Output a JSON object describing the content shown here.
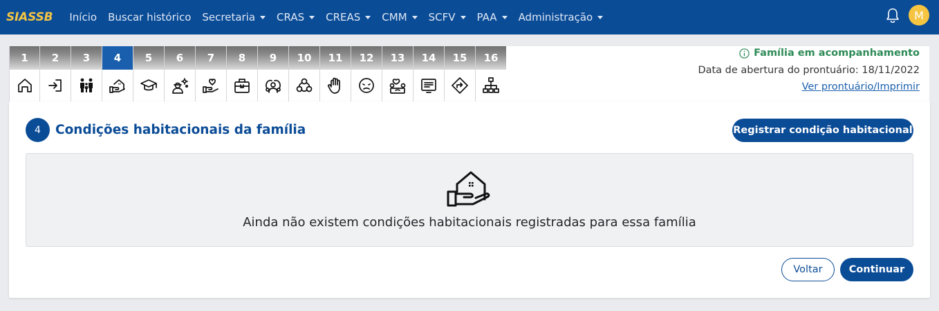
{
  "nav": {
    "brand": "SIASSB",
    "items": [
      {
        "label": "Início",
        "dropdown": false
      },
      {
        "label": "Buscar histórico",
        "dropdown": false
      },
      {
        "label": "Secretaria",
        "dropdown": true
      },
      {
        "label": "CRAS",
        "dropdown": true
      },
      {
        "label": "CREAS",
        "dropdown": true
      },
      {
        "label": "CMM",
        "dropdown": true
      },
      {
        "label": "SCFV",
        "dropdown": true
      },
      {
        "label": "PAA",
        "dropdown": true
      },
      {
        "label": "Administração",
        "dropdown": true
      }
    ],
    "notification_icon": "bell-icon",
    "avatar_initial": "M"
  },
  "steps": [
    {
      "num": "1",
      "icon": "home"
    },
    {
      "num": "2",
      "icon": "sign-in"
    },
    {
      "num": "3",
      "icon": "family"
    },
    {
      "num": "4",
      "icon": "house-hand",
      "active": true
    },
    {
      "num": "5",
      "icon": "graduation-cap"
    },
    {
      "num": "6",
      "icon": "worker"
    },
    {
      "num": "7",
      "icon": "heart-hand"
    },
    {
      "num": "8",
      "icon": "briefcase"
    },
    {
      "num": "9",
      "icon": "people-group"
    },
    {
      "num": "10",
      "icon": "bio-link"
    },
    {
      "num": "11",
      "icon": "hand-stop"
    },
    {
      "num": "12",
      "icon": "face"
    },
    {
      "num": "13",
      "icon": "people-heart"
    },
    {
      "num": "14",
      "icon": "document-screen"
    },
    {
      "num": "15",
      "icon": "direction-sign"
    },
    {
      "num": "16",
      "icon": "hierarchy"
    }
  ],
  "info": {
    "status": "Família em acompanhamento",
    "open_date": "Data de abertura do prontuário: 18/11/2022",
    "view_link": "Ver prontuário/Imprimir"
  },
  "section": {
    "number": "4",
    "title": "Condições habitacionais da família",
    "register_button": "Registrar condição habitacional",
    "empty_message": "Ainda não existem condições habitacionais registradas para essa família",
    "back_button": "Voltar",
    "continue_button": "Continuar"
  },
  "colors": {
    "primary": "#0b4c97",
    "brand_accent": "#f5c542",
    "status_green": "#2e8b57"
  }
}
